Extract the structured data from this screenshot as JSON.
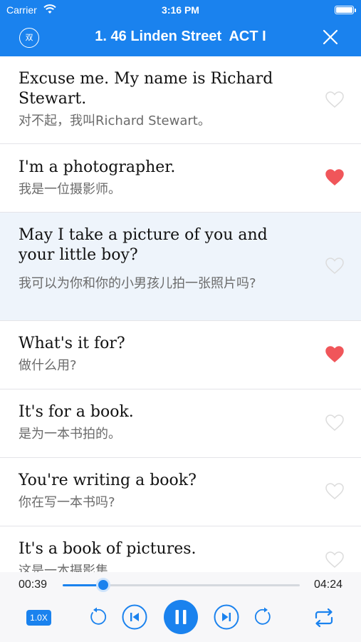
{
  "status_bar": {
    "carrier": "Carrier",
    "time": "3:16 PM"
  },
  "nav": {
    "dual_label": "双",
    "title": "1. 46 Linden Street  ACT I"
  },
  "sentences": [
    {
      "en": "Excuse me. My name is Richard Stewart.",
      "zh": "对不起，我叫Richard Stewart。",
      "favorited": false,
      "active": false
    },
    {
      "en": "I'm a photographer.",
      "zh": "我是一位摄影师。",
      "favorited": true,
      "active": false
    },
    {
      "en": "May I take a picture of you and your little boy?",
      "zh": "我可以为你和你的小男孩儿拍一张照片吗?",
      "favorited": false,
      "active": true
    },
    {
      "en": "What's it for?",
      "zh": "做什么用?",
      "favorited": true,
      "active": false
    },
    {
      "en": "It's for a book.",
      "zh": "是为一本书拍的。",
      "favorited": false,
      "active": false
    },
    {
      "en": "You're writing a book?",
      "zh": "你在写一本书吗?",
      "favorited": false,
      "active": false
    },
    {
      "en": "It's a book of pictures.",
      "zh": "这是一本摄影集",
      "favorited": false,
      "active": false
    }
  ],
  "player": {
    "current_time": "00:39",
    "total_time": "04:24",
    "progress": 0.17,
    "speed_label": "1.0X",
    "state": "playing"
  },
  "colors": {
    "accent": "#1a82ee",
    "heart_on": "#f0565a",
    "heart_off": "#dcdcdc",
    "active_row": "#eef4fb"
  },
  "icons": [
    "wifi-icon",
    "battery-icon",
    "close-icon",
    "heart-icon",
    "replay-back-icon",
    "previous-icon",
    "pause-icon",
    "next-icon",
    "replay-forward-icon",
    "repeat-icon"
  ]
}
